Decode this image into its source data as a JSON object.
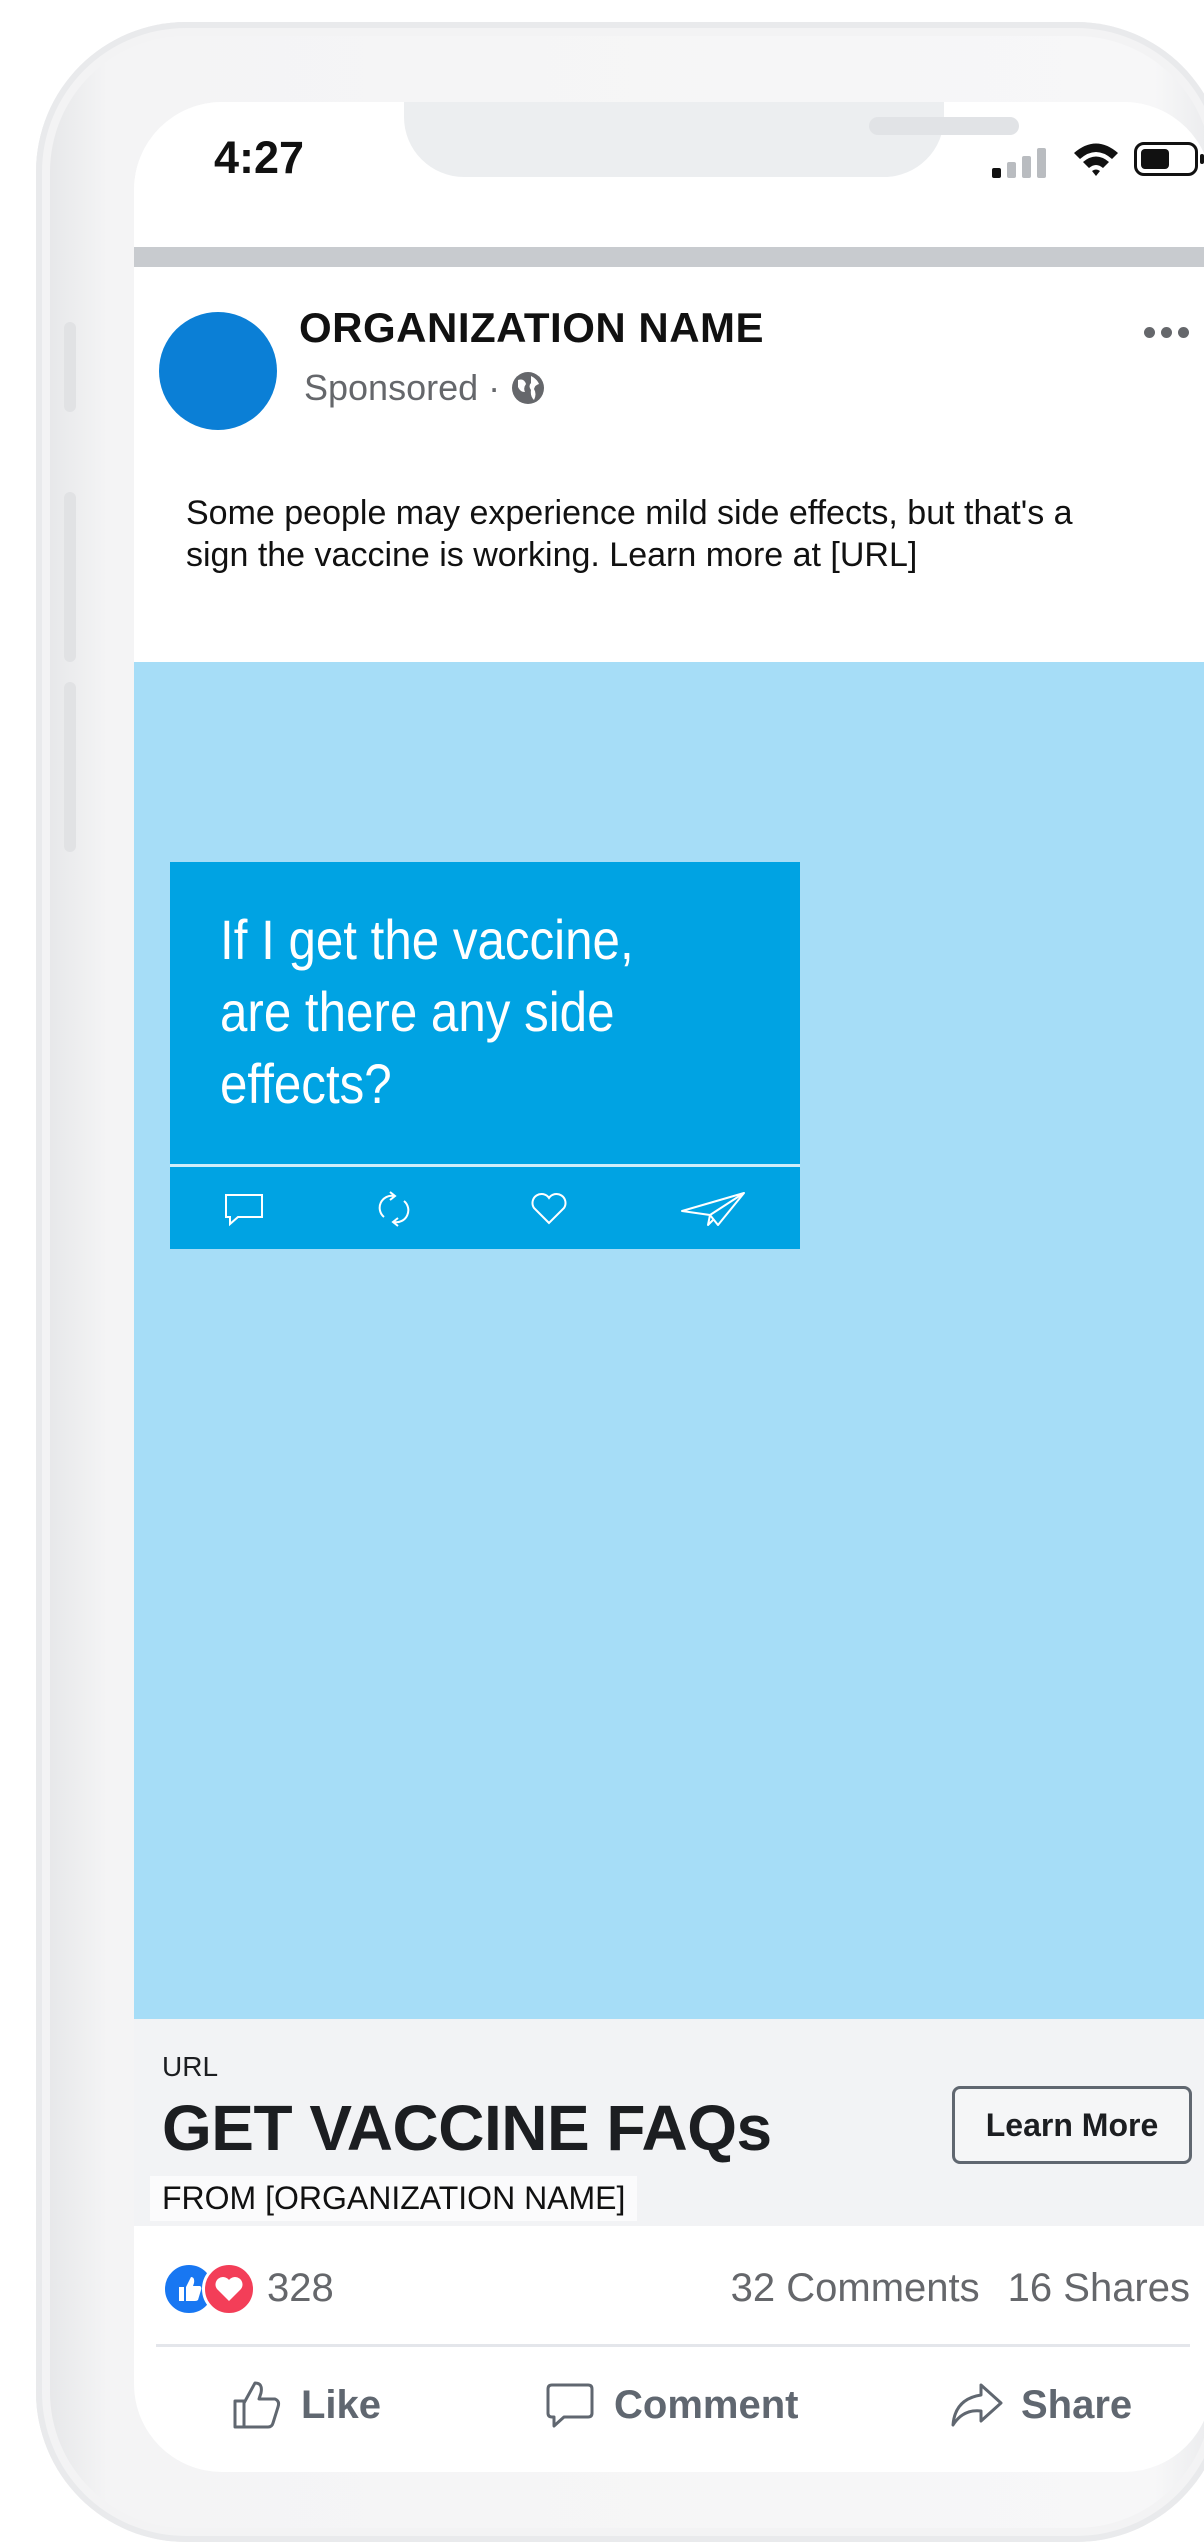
{
  "status_bar": {
    "time": "4:27"
  },
  "post": {
    "org_name": "ORGANIZATION NAME",
    "sponsored": "Sponsored",
    "separator": "·",
    "text": "Some people may experience mild side effects, but that's a sign the vaccine is working. Learn more at [URL]"
  },
  "card": {
    "question": "If I get the vaccine, are there any side effects?",
    "icons": [
      "comment-icon",
      "retweet-icon",
      "heart-icon",
      "paper-plane-icon"
    ]
  },
  "link": {
    "url_label": "URL",
    "headline": "GET VACCINE FAQs",
    "from": "FROM [ORGANIZATION NAME]",
    "cta": "Learn More"
  },
  "engagement": {
    "reactions_count": "328",
    "comments": "32 Comments",
    "shares": "16 Shares"
  },
  "actions": {
    "like": "Like",
    "comment": "Comment",
    "share": "Share"
  },
  "colors": {
    "avatar": "#0b7fd6",
    "media_bg": "#a6ddf7",
    "card_bg": "#00a3e3",
    "like_blue": "#1877f2",
    "love_red": "#f33e58"
  }
}
